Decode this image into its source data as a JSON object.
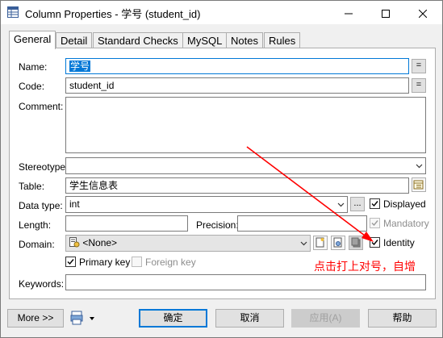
{
  "window": {
    "title": "Column Properties - 学号 (student_id)",
    "controls": {
      "minimize": "—",
      "maximize": "☐",
      "close": "✕"
    }
  },
  "tabs": [
    {
      "label": "General",
      "active": true
    },
    {
      "label": "Detail"
    },
    {
      "label": "Standard Checks"
    },
    {
      "label": "MySQL"
    },
    {
      "label": "Notes"
    },
    {
      "label": "Rules"
    }
  ],
  "form": {
    "name": {
      "label": "Name:",
      "value": "学号",
      "btn": "="
    },
    "code": {
      "label": "Code:",
      "value": "student_id",
      "btn": "="
    },
    "comment": {
      "label": "Comment:",
      "value": ""
    },
    "stereotype": {
      "label": "Stereotype:",
      "value": ""
    },
    "table": {
      "label": "Table:",
      "value": "学生信息表"
    },
    "data_type": {
      "label": "Data type:",
      "value": "int",
      "btn": "..."
    },
    "displayed": {
      "label": "Displayed",
      "checked": true
    },
    "length": {
      "label": "Length:",
      "value": ""
    },
    "precision": {
      "label": "Precision:",
      "value": ""
    },
    "mandatory": {
      "label": "Mandatory",
      "checked": true,
      "disabled": true
    },
    "domain": {
      "label": "Domain:",
      "value": "<None>"
    },
    "identity": {
      "label": "Identity",
      "checked": true
    },
    "primary_key": {
      "label": "Primary key",
      "checked": true
    },
    "foreign_key": {
      "label": "Foreign key",
      "checked": false,
      "disabled": true
    },
    "keywords": {
      "label": "Keywords:",
      "value": ""
    }
  },
  "annotation": {
    "text": "点击打上对号，自增",
    "color": "#ff0000"
  },
  "footer": {
    "more": "More >>",
    "ok": "确定",
    "cancel": "取消",
    "apply": "应用(A)",
    "help": "帮助"
  }
}
